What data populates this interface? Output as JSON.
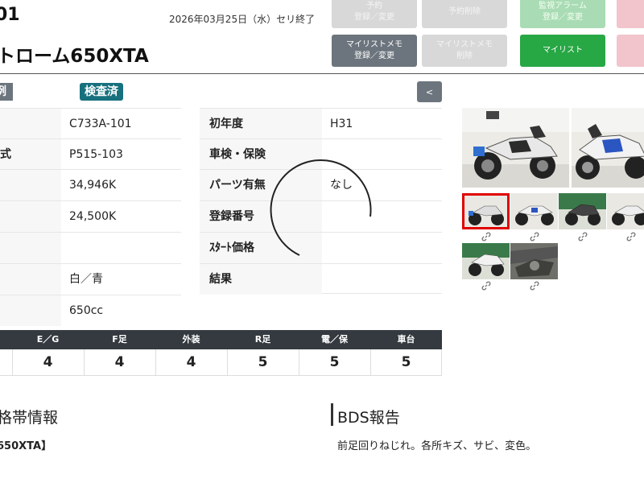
{
  "header": {
    "lot_no": "01",
    "auction_end": "2026年03月25日（水）セリ終了",
    "model_name": "トローム650XTA"
  },
  "top_buttons": [
    {
      "line1": "予約",
      "line2": "登録／変更",
      "style": "gray"
    },
    {
      "line1": "予約削除",
      "line2": "",
      "style": "gray"
    },
    {
      "line1": "監視アラーム",
      "line2": "登録／変更",
      "style": "green-light"
    },
    {
      "line1": "",
      "line2": "",
      "style": "pink"
    },
    {
      "line1": "マイリストメモ",
      "line2": "登録／変更",
      "style": "dark"
    },
    {
      "line1": "マイリストメモ",
      "line2": "削除",
      "style": "gray"
    },
    {
      "line1": "マイリスト",
      "line2": "",
      "style": "green"
    },
    {
      "line1": "",
      "line2": "",
      "style": "pink"
    }
  ],
  "badges": {
    "left": "例",
    "inspection": "検査済",
    "collapse": "<"
  },
  "specs_left": [
    {
      "label": "",
      "value": "C733A-101"
    },
    {
      "label": "式",
      "value": "P515-103"
    },
    {
      "label": "",
      "value": "34,946K"
    },
    {
      "label": "",
      "value": "24,500K"
    },
    {
      "label": "",
      "value": ""
    },
    {
      "label": "",
      "value": "白／青"
    },
    {
      "label": "",
      "value": "650cc"
    }
  ],
  "specs_right": [
    {
      "label": "初年度",
      "value": "H31"
    },
    {
      "label": "車検・保険",
      "value": ""
    },
    {
      "label": "パーツ有無",
      "value": "なし"
    },
    {
      "label": "登録番号",
      "value": ""
    },
    {
      "label": "ｽﾀｰﾄ価格",
      "value": ""
    },
    {
      "label": "結果",
      "value": ""
    }
  ],
  "grades": {
    "headers": [
      "",
      "E／G",
      "F足",
      "外装",
      "R足",
      "電／保",
      "車台"
    ],
    "values": [
      "",
      "4",
      "4",
      "4",
      "5",
      "5",
      "5"
    ]
  },
  "sections": {
    "left_title": "格帯情報",
    "left_sub": "650XTA】",
    "right_title": "BDS報告",
    "bds_text": "前足回りねじれ。各所キズ、サビ、変色。"
  },
  "colors": {
    "green": "#28a745",
    "dark_gray": "#6c757d",
    "teal": "#17707e",
    "grade_header": "#343a40",
    "selected_border": "#e00000"
  }
}
